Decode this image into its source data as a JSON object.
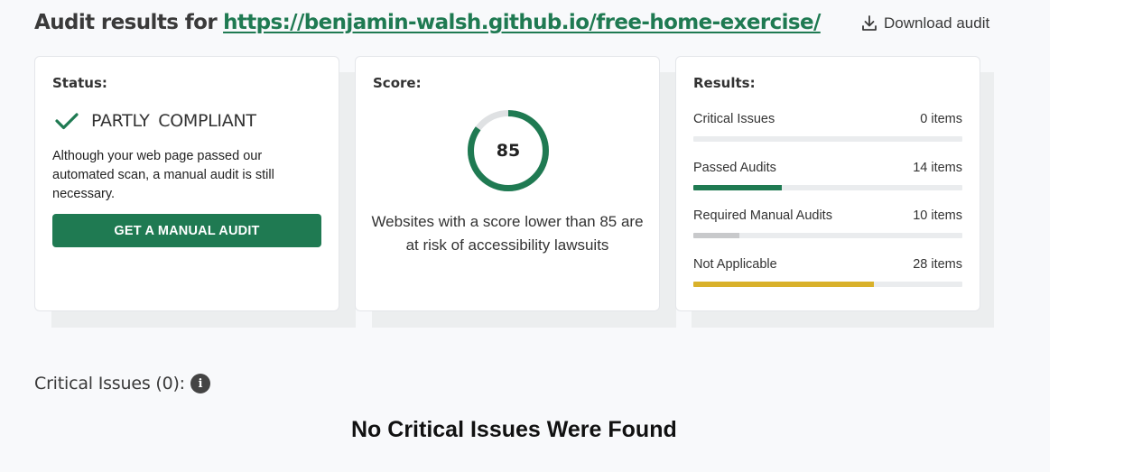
{
  "header": {
    "title": "Audit results for",
    "url": "https://benjamin-walsh.github.io/free-home-exercise/",
    "download_label": "Download audit"
  },
  "status_card": {
    "label": "Status:",
    "status": "PARTLY COMPLIANT",
    "description": "Although your web page passed our automated scan, a manual audit is still necessary.",
    "button_label": "GET A MANUAL AUDIT"
  },
  "score_card": {
    "label": "Score:",
    "score": "85",
    "score_fraction": 0.85,
    "description": "Websites with a score lower than 85 are at risk of accessibility lawsuits"
  },
  "results_card": {
    "label": "Results:",
    "items": [
      {
        "name": "Critical Issues",
        "count": "0 items",
        "fill": 0.0,
        "color": "#e03a3a"
      },
      {
        "name": "Passed Audits",
        "count": "14 items",
        "fill": 0.33,
        "color": "#1f7a52"
      },
      {
        "name": "Required Manual Audits",
        "count": "10 items",
        "fill": 0.17,
        "color": "#c8c9cb"
      },
      {
        "name": "Not Applicable",
        "count": "28 items",
        "fill": 0.67,
        "color": "#d9b12a"
      }
    ]
  },
  "critical_section": {
    "title": "Critical Issues (0):",
    "info_icon": "info-icon",
    "empty_message": "No Critical Issues Were Found"
  },
  "colors": {
    "accent": "#1f7a52",
    "ring_track": "#dfe1e3"
  }
}
